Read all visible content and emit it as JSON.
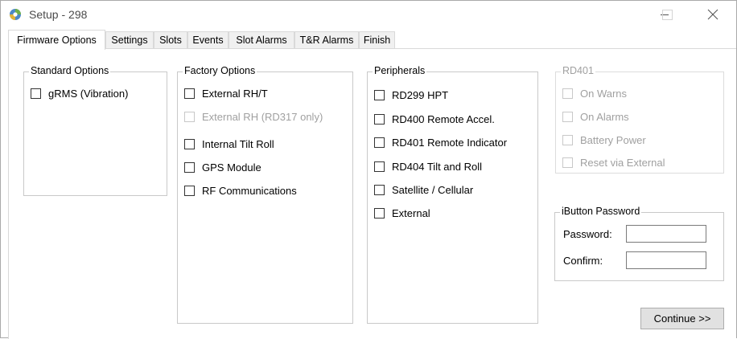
{
  "window": {
    "title": "Setup - 298",
    "icon": "setup-app-icon",
    "controls": [
      "minimize-icon",
      "maximize-icon",
      "close-icon"
    ]
  },
  "tabs": [
    {
      "label": "Firmware Options",
      "active": true
    },
    {
      "label": "Settings",
      "active": false
    },
    {
      "label": "Slots",
      "active": false
    },
    {
      "label": "Events",
      "active": false
    },
    {
      "label": "Slot Alarms",
      "active": false
    },
    {
      "label": "T&R Alarms",
      "active": false
    },
    {
      "label": "Finish",
      "active": false
    }
  ],
  "standard_options": {
    "title": "Standard Options",
    "items": [
      {
        "label": "gRMS (Vibration)",
        "checked": false,
        "enabled": true
      }
    ]
  },
  "factory_options": {
    "title": "Factory Options",
    "items": [
      {
        "label": "External RH/T",
        "checked": false,
        "enabled": true
      },
      {
        "label": "External RH (RD317 only)",
        "checked": false,
        "enabled": false
      },
      {
        "label": "Internal Tilt  Roll",
        "checked": false,
        "enabled": true
      },
      {
        "label": "GPS Module",
        "checked": false,
        "enabled": true
      },
      {
        "label": "RF Communications",
        "checked": false,
        "enabled": true
      }
    ]
  },
  "peripherals": {
    "title": "Peripherals",
    "items": [
      {
        "label": "RD299 HPT",
        "checked": false,
        "enabled": true
      },
      {
        "label": "RD400 Remote Accel.",
        "checked": false,
        "enabled": true
      },
      {
        "label": "RD401 Remote Indicator",
        "checked": false,
        "enabled": true
      },
      {
        "label": "RD404 Tilt and Roll",
        "checked": false,
        "enabled": true
      },
      {
        "label": "Satellite / Cellular",
        "checked": false,
        "enabled": true
      },
      {
        "label": "External",
        "checked": false,
        "enabled": true
      }
    ]
  },
  "rd401": {
    "title": "RD401",
    "items": [
      {
        "label": "On Warns",
        "checked": false,
        "enabled": false
      },
      {
        "label": "On Alarms",
        "checked": false,
        "enabled": false
      },
      {
        "label": "Battery Power",
        "checked": false,
        "enabled": false
      },
      {
        "label": "Reset via External",
        "checked": false,
        "enabled": false
      }
    ]
  },
  "ibutton": {
    "title": "iButton Password",
    "password_label": "Password:",
    "password_value": "",
    "confirm_label": "Confirm:",
    "confirm_value": ""
  },
  "continue_button": "Continue >>"
}
